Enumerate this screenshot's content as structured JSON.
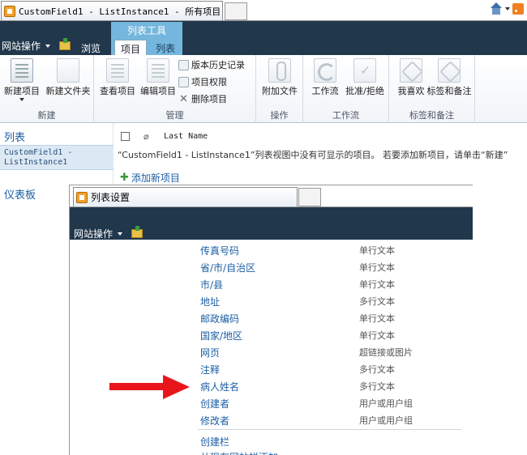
{
  "browser": {
    "tab_title": "CustomField1 - ListInstance1 - 所有项目"
  },
  "ribbon": {
    "site_actions": "网站操作",
    "browse_tab": "浏览",
    "context_group": "列表工具",
    "tab_items": "项目",
    "tab_list": "列表",
    "groups": {
      "new": {
        "label": "新建",
        "new_item": "新建项目",
        "new_folder": "新建文件夹"
      },
      "manage": {
        "label": "管理",
        "view_item": "查看项目",
        "edit_item": "编辑项目",
        "version_history": "版本历史记录",
        "item_permissions": "项目权限",
        "delete_item": "删除项目"
      },
      "actions": {
        "label": "操作",
        "attach_file": "附加文件"
      },
      "workflow": {
        "label": "工作流",
        "workflows": "工作流",
        "approve_reject": "批准/拒绝"
      },
      "tags": {
        "label": "标签和备注",
        "i_like_it": "我喜欢",
        "tags_notes": "标签和备注"
      }
    }
  },
  "leftnav": {
    "lists_heading": "列表",
    "current_list": "CustomField1 - ListInstance1",
    "dashboards_heading": "仪表板"
  },
  "list": {
    "column_last_name": "Last Name",
    "empty_message": "“CustomField1 - ListInstance1”列表视图中没有可显示的项目。 若要添加新项目，请单击“新建”",
    "add_new_item": "添加新项目"
  },
  "overlay": {
    "tab_title": "列表设置",
    "site_actions": "网站操作",
    "fields": [
      {
        "name": "传真号码",
        "type": "单行文本"
      },
      {
        "name": "省/市/自治区",
        "type": "单行文本"
      },
      {
        "name": "市/县",
        "type": "单行文本"
      },
      {
        "name": "地址",
        "type": "多行文本"
      },
      {
        "name": "邮政编码",
        "type": "单行文本"
      },
      {
        "name": "国家/地区",
        "type": "单行文本"
      },
      {
        "name": "网页",
        "type": "超链接或图片"
      },
      {
        "name": "注释",
        "type": "多行文本"
      },
      {
        "name": "病人姓名",
        "type": "多行文本"
      },
      {
        "name": "创建者",
        "type": "用户或用户组"
      },
      {
        "name": "修改者",
        "type": "用户或用户组"
      }
    ],
    "create_column": "创建栏",
    "next_link": "从现有网站栏添加"
  },
  "colors": {
    "ribbon_dark": "#21374c",
    "context_tab": "#74b6dd",
    "link_blue": "#1d5fa4",
    "arrow_red": "#e8161a"
  }
}
